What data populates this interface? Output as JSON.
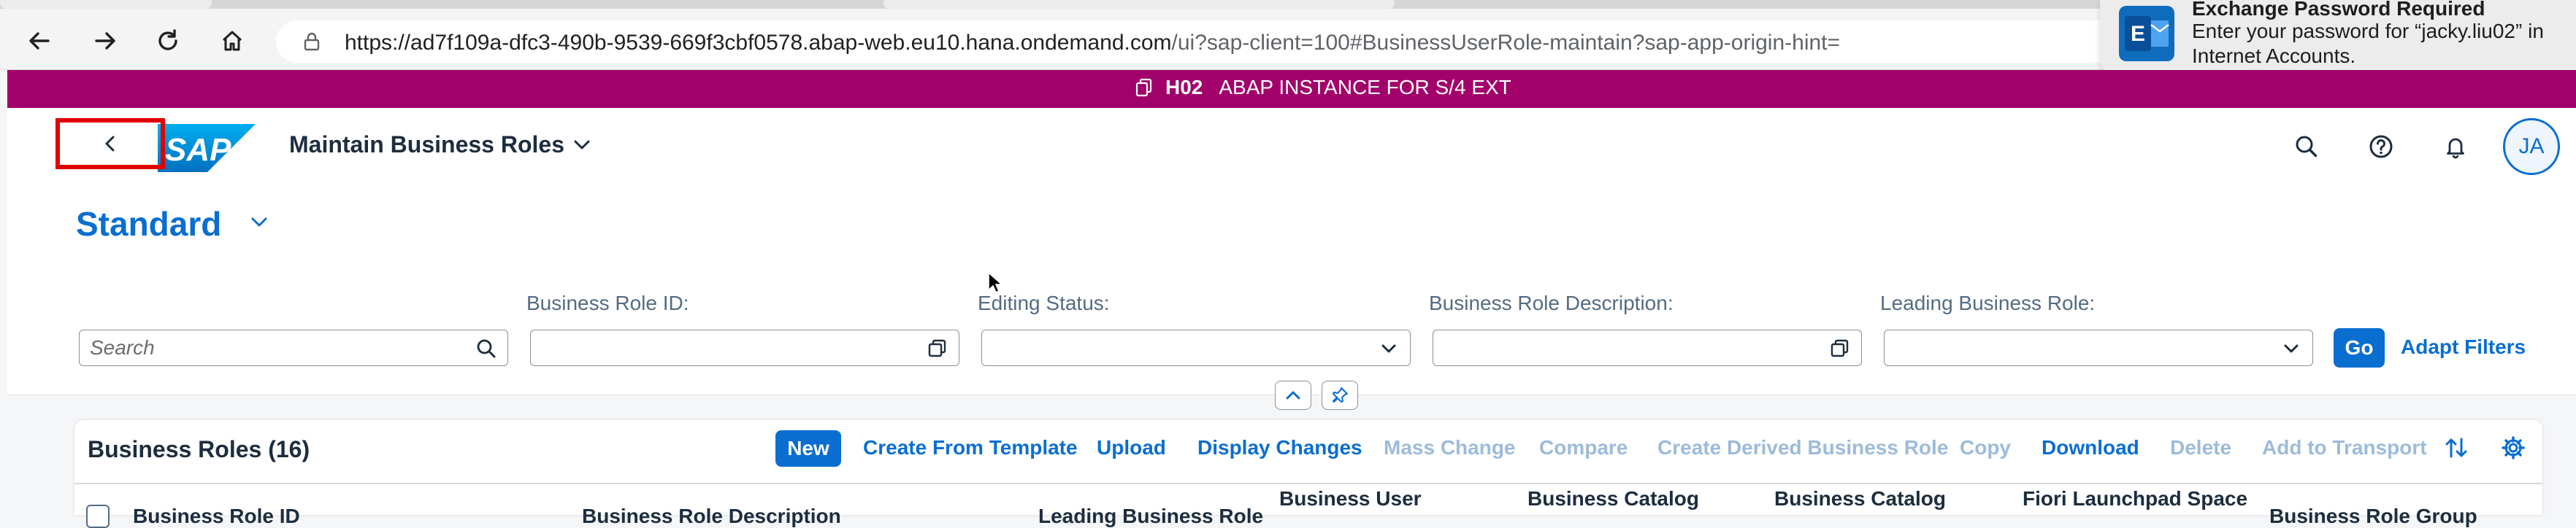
{
  "browser": {
    "url_main": "https://ad7f109a-dfc3-490b-9539-669f3cbf0578.abap-web.eu10.hana.ondemand.com",
    "url_rest": "/ui?sap-client=100#BusinessUserRole-maintain?sap-app-origin-hint="
  },
  "notification": {
    "title": "Exchange Password Required",
    "body": "Enter your password for “jacky.liu02” in Internet Accounts."
  },
  "system_bar": {
    "system_id": "H02",
    "description": "ABAP INSTANCE FOR S/4 EXT"
  },
  "shell": {
    "app_title": "Maintain Business Roles",
    "avatar_initials": "JA"
  },
  "filterbar": {
    "variant": "Standard",
    "search_placeholder": "Search",
    "labels": {
      "role_id": "Business Role ID:",
      "editing_status": "Editing Status:",
      "role_description": "Business Role Description:",
      "leading_role": "Leading Business Role:"
    },
    "go": "Go",
    "adapt_filters": "Adapt Filters"
  },
  "table": {
    "title": "Business Roles (16)",
    "actions": {
      "new": "New",
      "create_from_template": "Create From Template",
      "upload": "Upload",
      "display_changes": "Display Changes",
      "mass_change": "Mass Change",
      "compare": "Compare",
      "create_derived": "Create Derived Business Role",
      "copy": "Copy",
      "download": "Download",
      "delete": "Delete",
      "add_to_transport": "Add to Transport"
    },
    "columns": {
      "role_id": "Business Role ID",
      "role_description": "Business Role Description",
      "leading_role": "Leading Business Role",
      "business_user": "Business User",
      "catalog_1": "Business Catalog",
      "catalog_2": "Business Catalog",
      "launchpad_space": "Fiori Launchpad Space",
      "role_group": "Business Role Group"
    }
  },
  "colors": {
    "accent": "#0a6ed1",
    "system_bar": "#a2006a",
    "highlight_box": "#e00000"
  }
}
